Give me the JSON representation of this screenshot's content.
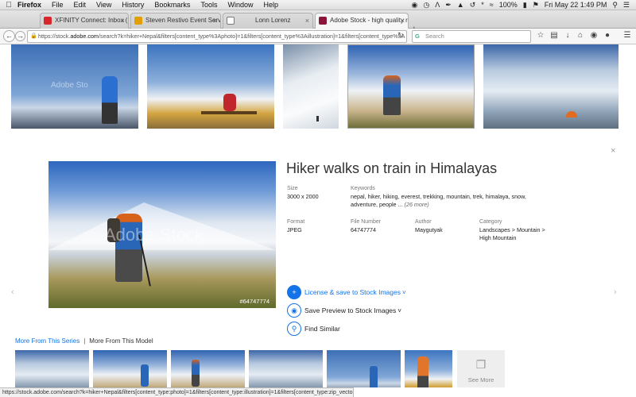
{
  "menubar": {
    "app": "Firefox",
    "items": [
      "File",
      "Edit",
      "View",
      "History",
      "Bookmarks",
      "Tools",
      "Window",
      "Help"
    ],
    "battery": "100%",
    "clock": "Fri May 22  1:49 PM"
  },
  "tabs": [
    {
      "title": "XFINITY Connect: Inbox (863)",
      "fav_color": "#d9262b"
    },
    {
      "title": "Steven Restivo Event Servic...",
      "fav_color": "#e2a000"
    },
    {
      "title": "Lonn Lorenz",
      "fav_color": "#7a7a7a"
    },
    {
      "title": "Adobe Stock - high quality r...",
      "fav_color": "#8a1538"
    }
  ],
  "navbar": {
    "url_prefix": "https://stock.",
    "url_host": "adobe.com",
    "url_rest": "/search?k=hiker+Nepal&filters[content_type%3Aphoto]=1&filters[content_type%3Aillustration]=1&filters[content_type%3A",
    "search_placeholder": "Search"
  },
  "top_thumbs": {
    "watermark": "Adobe Sto"
  },
  "detail": {
    "title": "Hiker walks on train in Himalayas",
    "size_label": "Size",
    "size_value": "3000 x 2000",
    "keywords_label": "Keywords",
    "keywords_value": "nepal, hiker, hiking, everest, trekking, mountain, trek, himalaya, snow, adventure, people ...",
    "keywords_more": "(26 more)",
    "format_label": "Format",
    "format_value": "JPEG",
    "file_number_label": "File Number",
    "file_number_value": "64747774",
    "author_label": "Author",
    "author_value": "Maygutyak",
    "category_label": "Category",
    "category_value_1": "Landscapes > Mountain >",
    "category_value_2": "High Mountain",
    "image_watermark": "Adobe Stock",
    "image_file_id": "#64747774",
    "close_glyph": "×"
  },
  "actions": {
    "license": "License & save to Stock Images",
    "preview": "Save Preview to Stock Images",
    "similar": "Find Similar"
  },
  "series": {
    "tab_series": "More From This Series",
    "separator": "|",
    "tab_model": "More From This Model",
    "see_more": "See More"
  },
  "statusbar": {
    "text": "https://stock.adobe.com/search?k=hiker+Nepal&filters[content_type:photo]=1&filters[content_type:illustration]=1&filters[content_type:zip_vector]=1#"
  },
  "icons": {
    "apple": "apple-logo-icon",
    "back": "back-arrow-icon",
    "forward": "forward-arrow-icon",
    "lock": "lock-icon",
    "reload": "reload-icon",
    "star": "bookmark-star-icon",
    "reading_list": "reading-list-icon",
    "download": "download-icon",
    "home": "home-icon",
    "chat": "chat-icon",
    "menu": "hamburger-menu-icon",
    "cart": "cart-icon",
    "eye": "eye-icon",
    "magnifier": "magnifier-icon",
    "stack": "stack-icon"
  },
  "colors": {
    "accent": "#1473e6"
  }
}
